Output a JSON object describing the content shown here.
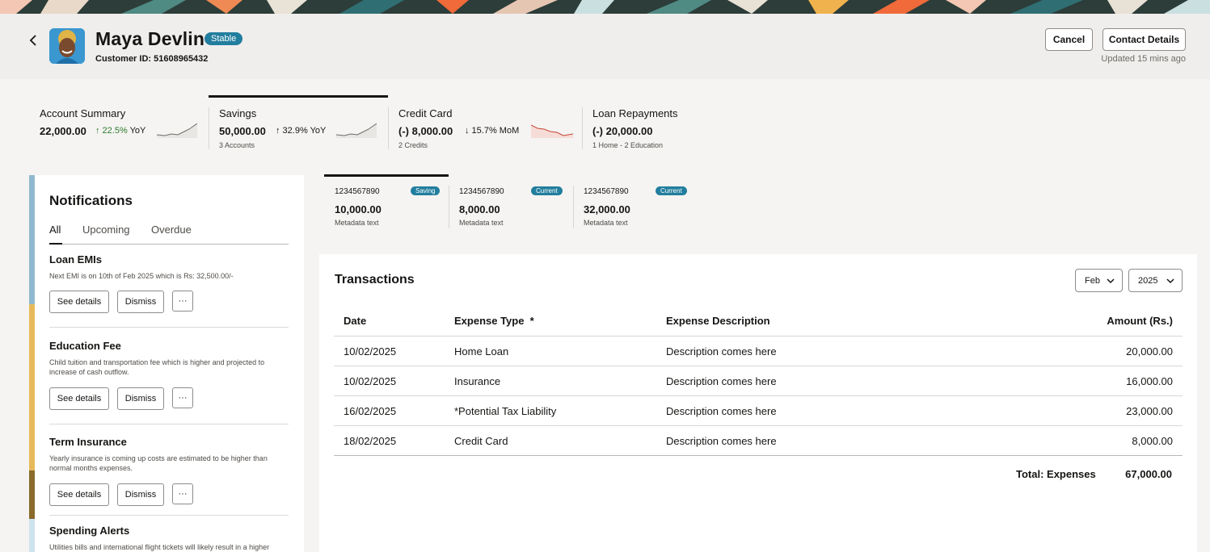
{
  "header": {
    "name": "Maya Devlin",
    "status_badge": "Stable",
    "customer_id": "Customer ID: 51608965432",
    "cancel_label": "Cancel",
    "contact_label": "Contact Details",
    "updated": "Updated 15 mins ago"
  },
  "kpis": [
    {
      "label": "Account Summary",
      "value": "22,000.00",
      "change": "↑ 22.5%",
      "change_suffix": " YoY",
      "meta": "",
      "trend": "up",
      "change_color": "#2d7a2d"
    },
    {
      "label": "Savings",
      "value": "50,000.00",
      "change": "↑ 32.9%",
      "change_suffix": " YoY",
      "meta": "3 Accounts",
      "trend": "up",
      "change_color": "#161513"
    },
    {
      "label": "Credit Card",
      "value": "(-) 8,000.00",
      "change": "↓ 15.7%",
      "change_suffix": " MoM",
      "meta": "2 Credits",
      "trend": "down",
      "change_color": "#161513"
    },
    {
      "label": "Loan Repayments",
      "value": "(-) 20,000.00",
      "change": "",
      "change_suffix": "",
      "meta": "1 Home - 2 Education",
      "trend": "none",
      "change_color": "#161513"
    }
  ],
  "notifications": {
    "title": "Notifications",
    "tabs": [
      "All",
      "Upcoming",
      "Overdue"
    ],
    "active_tab": "All",
    "items": [
      {
        "title": "Loan EMIs",
        "desc": "Next EMI is on 10th of Feb 2025 which is Rs: 32,500.00/-",
        "see": "See details",
        "dismiss": "Dismiss",
        "more": "···"
      },
      {
        "title": "Education Fee",
        "desc": "Child tuition and transportation fee which is higher and projected to increase of cash outflow.",
        "see": "See details",
        "dismiss": "Dismiss",
        "more": "···"
      },
      {
        "title": "Term Insurance",
        "desc": "Yearly insurance is coming up costs are estimated to be higher than normal months expenses.",
        "see": "See details",
        "dismiss": "Dismiss",
        "more": "···"
      },
      {
        "title": "Spending Alerts",
        "desc": "Utilities bills and international flight tickets will likely result in a higher",
        "see": "",
        "dismiss": "",
        "more": ""
      }
    ],
    "stripe_colors": [
      "#8fb9cf",
      "#e6b95a",
      "#8a6a2a",
      "#cde3ee"
    ]
  },
  "accounts": [
    {
      "number": "1234567890",
      "tag": "Saving",
      "amount": "10,000.00",
      "meta": "Metadata text"
    },
    {
      "number": "1234567890",
      "tag": "Current",
      "amount": "8,000.00",
      "meta": "Metadata text"
    },
    {
      "number": "1234567890",
      "tag": "Current",
      "amount": "32,000.00",
      "meta": "Metadata text"
    }
  ],
  "transactions": {
    "title": "Transactions",
    "month": "Feb",
    "year": "2025",
    "columns": [
      "Date",
      "Expense Type  *",
      "Expense Description",
      "Amount (Rs.)"
    ],
    "rows": [
      [
        "10/02/2025",
        "Home Loan",
        "Description comes here",
        "20,000.00"
      ],
      [
        "10/02/2025",
        "Insurance",
        "Description comes here",
        "16,000.00"
      ],
      [
        "16/02/2025",
        "*Potential Tax Liability",
        "Description comes here",
        "23,000.00"
      ],
      [
        "18/02/2025",
        "Credit Card",
        "Description comes here",
        "8,000.00"
      ]
    ],
    "total_label": "Total: Expenses",
    "total_value": "67,000.00"
  },
  "colors": {
    "accent": "#227e9e",
    "positive": "#2d7a2d",
    "negative": "#c74634"
  }
}
